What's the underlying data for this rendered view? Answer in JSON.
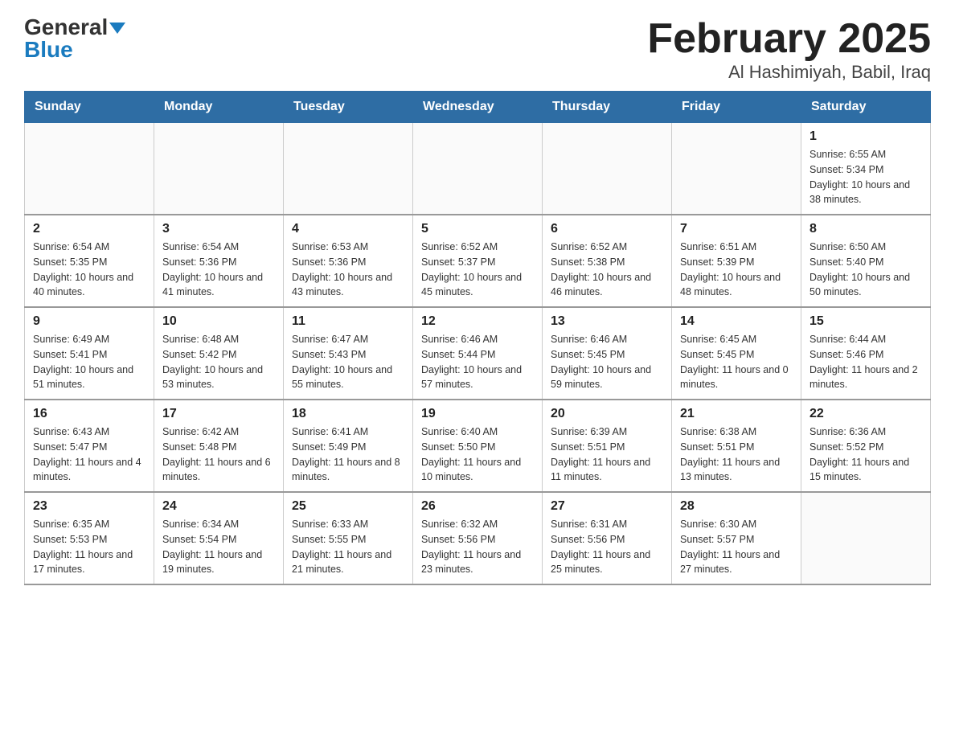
{
  "logo": {
    "general": "General",
    "blue": "Blue"
  },
  "title": "February 2025",
  "subtitle": "Al Hashimiyah, Babil, Iraq",
  "days_of_week": [
    "Sunday",
    "Monday",
    "Tuesday",
    "Wednesday",
    "Thursday",
    "Friday",
    "Saturday"
  ],
  "weeks": [
    [
      {
        "day": "",
        "info": ""
      },
      {
        "day": "",
        "info": ""
      },
      {
        "day": "",
        "info": ""
      },
      {
        "day": "",
        "info": ""
      },
      {
        "day": "",
        "info": ""
      },
      {
        "day": "",
        "info": ""
      },
      {
        "day": "1",
        "info": "Sunrise: 6:55 AM\nSunset: 5:34 PM\nDaylight: 10 hours and 38 minutes."
      }
    ],
    [
      {
        "day": "2",
        "info": "Sunrise: 6:54 AM\nSunset: 5:35 PM\nDaylight: 10 hours and 40 minutes."
      },
      {
        "day": "3",
        "info": "Sunrise: 6:54 AM\nSunset: 5:36 PM\nDaylight: 10 hours and 41 minutes."
      },
      {
        "day": "4",
        "info": "Sunrise: 6:53 AM\nSunset: 5:36 PM\nDaylight: 10 hours and 43 minutes."
      },
      {
        "day": "5",
        "info": "Sunrise: 6:52 AM\nSunset: 5:37 PM\nDaylight: 10 hours and 45 minutes."
      },
      {
        "day": "6",
        "info": "Sunrise: 6:52 AM\nSunset: 5:38 PM\nDaylight: 10 hours and 46 minutes."
      },
      {
        "day": "7",
        "info": "Sunrise: 6:51 AM\nSunset: 5:39 PM\nDaylight: 10 hours and 48 minutes."
      },
      {
        "day": "8",
        "info": "Sunrise: 6:50 AM\nSunset: 5:40 PM\nDaylight: 10 hours and 50 minutes."
      }
    ],
    [
      {
        "day": "9",
        "info": "Sunrise: 6:49 AM\nSunset: 5:41 PM\nDaylight: 10 hours and 51 minutes."
      },
      {
        "day": "10",
        "info": "Sunrise: 6:48 AM\nSunset: 5:42 PM\nDaylight: 10 hours and 53 minutes."
      },
      {
        "day": "11",
        "info": "Sunrise: 6:47 AM\nSunset: 5:43 PM\nDaylight: 10 hours and 55 minutes."
      },
      {
        "day": "12",
        "info": "Sunrise: 6:46 AM\nSunset: 5:44 PM\nDaylight: 10 hours and 57 minutes."
      },
      {
        "day": "13",
        "info": "Sunrise: 6:46 AM\nSunset: 5:45 PM\nDaylight: 10 hours and 59 minutes."
      },
      {
        "day": "14",
        "info": "Sunrise: 6:45 AM\nSunset: 5:45 PM\nDaylight: 11 hours and 0 minutes."
      },
      {
        "day": "15",
        "info": "Sunrise: 6:44 AM\nSunset: 5:46 PM\nDaylight: 11 hours and 2 minutes."
      }
    ],
    [
      {
        "day": "16",
        "info": "Sunrise: 6:43 AM\nSunset: 5:47 PM\nDaylight: 11 hours and 4 minutes."
      },
      {
        "day": "17",
        "info": "Sunrise: 6:42 AM\nSunset: 5:48 PM\nDaylight: 11 hours and 6 minutes."
      },
      {
        "day": "18",
        "info": "Sunrise: 6:41 AM\nSunset: 5:49 PM\nDaylight: 11 hours and 8 minutes."
      },
      {
        "day": "19",
        "info": "Sunrise: 6:40 AM\nSunset: 5:50 PM\nDaylight: 11 hours and 10 minutes."
      },
      {
        "day": "20",
        "info": "Sunrise: 6:39 AM\nSunset: 5:51 PM\nDaylight: 11 hours and 11 minutes."
      },
      {
        "day": "21",
        "info": "Sunrise: 6:38 AM\nSunset: 5:51 PM\nDaylight: 11 hours and 13 minutes."
      },
      {
        "day": "22",
        "info": "Sunrise: 6:36 AM\nSunset: 5:52 PM\nDaylight: 11 hours and 15 minutes."
      }
    ],
    [
      {
        "day": "23",
        "info": "Sunrise: 6:35 AM\nSunset: 5:53 PM\nDaylight: 11 hours and 17 minutes."
      },
      {
        "day": "24",
        "info": "Sunrise: 6:34 AM\nSunset: 5:54 PM\nDaylight: 11 hours and 19 minutes."
      },
      {
        "day": "25",
        "info": "Sunrise: 6:33 AM\nSunset: 5:55 PM\nDaylight: 11 hours and 21 minutes."
      },
      {
        "day": "26",
        "info": "Sunrise: 6:32 AM\nSunset: 5:56 PM\nDaylight: 11 hours and 23 minutes."
      },
      {
        "day": "27",
        "info": "Sunrise: 6:31 AM\nSunset: 5:56 PM\nDaylight: 11 hours and 25 minutes."
      },
      {
        "day": "28",
        "info": "Sunrise: 6:30 AM\nSunset: 5:57 PM\nDaylight: 11 hours and 27 minutes."
      },
      {
        "day": "",
        "info": ""
      }
    ]
  ]
}
